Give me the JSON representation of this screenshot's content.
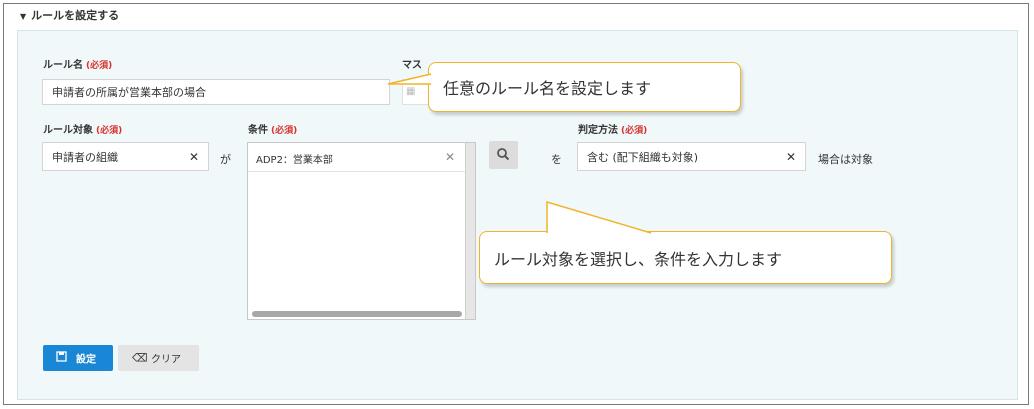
{
  "section": {
    "title": "ルールを設定する",
    "toggle_icon": "triangle-down-icon"
  },
  "required_mark": "(必須)",
  "rule_name": {
    "label": "ルール名",
    "value": "申請者の所属が営業本部の場合"
  },
  "mask_label_partial": "マス",
  "rule_target": {
    "label": "ルール対象",
    "value": "申請者の組織"
  },
  "connector_ga": "が",
  "condition": {
    "label": "条件",
    "values": [
      "ADP2：営業本部"
    ]
  },
  "connector_wo": "を",
  "judgment": {
    "label": "判定方法",
    "value": "含む (配下組織も対象)"
  },
  "suffix": "場合は対象",
  "buttons": {
    "set": "設定",
    "clear": "クリア"
  },
  "callouts": {
    "rule_name_tip": "任意のルール名を設定します",
    "target_tip": "ルール対象を選択し、条件を入力します"
  },
  "colors": {
    "primary": "#1a87d6",
    "required": "#d9302b",
    "callout_border": "#f0b429",
    "panel_bg": "#f0f8fa"
  }
}
